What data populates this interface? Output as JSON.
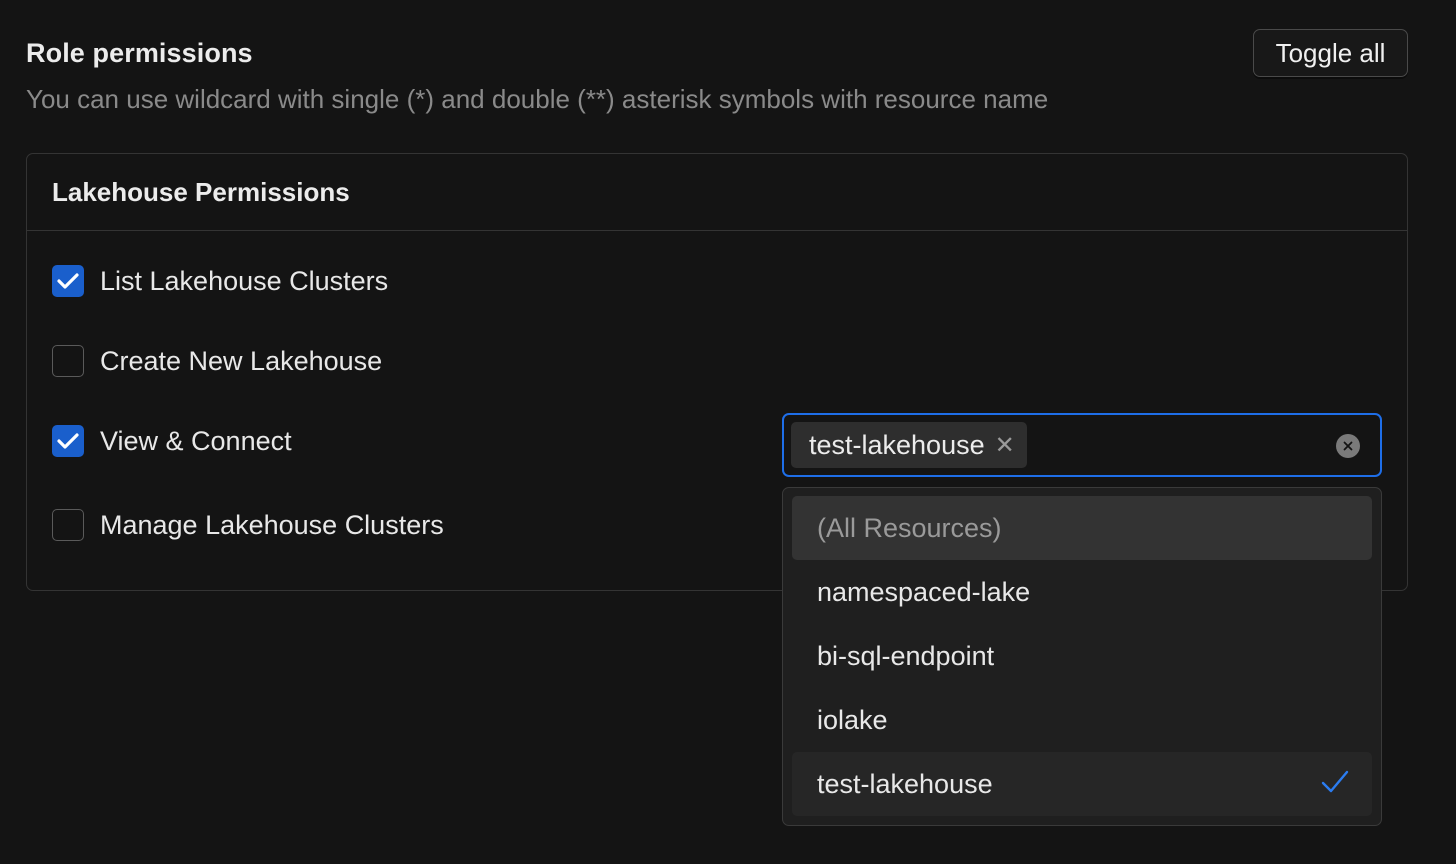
{
  "header": {
    "title": "Role permissions",
    "subtitle": "You can use wildcard with single (*) and double (**) asterisk symbols with resource name",
    "toggle_all_label": "Toggle all"
  },
  "card": {
    "title": "Lakehouse Permissions",
    "permissions": [
      {
        "label": "List Lakehouse Clusters",
        "checked": true
      },
      {
        "label": "Create New Lakehouse",
        "checked": false
      },
      {
        "label": "View & Connect",
        "checked": true
      },
      {
        "label": "Manage Lakehouse Clusters",
        "checked": false
      }
    ]
  },
  "resource_select": {
    "selected_tags": [
      "test-lakehouse"
    ],
    "options": [
      {
        "label": "(All Resources)",
        "state": "highlighted"
      },
      {
        "label": "namespaced-lake",
        "state": "normal"
      },
      {
        "label": "bi-sql-endpoint",
        "state": "normal"
      },
      {
        "label": "iolake",
        "state": "normal"
      },
      {
        "label": "test-lakehouse",
        "state": "selected"
      }
    ]
  },
  "colors": {
    "background": "#141414",
    "accent": "#1a5fcc",
    "focus_border": "#1e6ee8",
    "check_mark": "#2b7cf0"
  },
  "icons": {
    "checkbox_check": "check-icon",
    "tag_remove": "close-icon",
    "clear": "clear-circle-icon",
    "option_selected": "check-icon"
  }
}
